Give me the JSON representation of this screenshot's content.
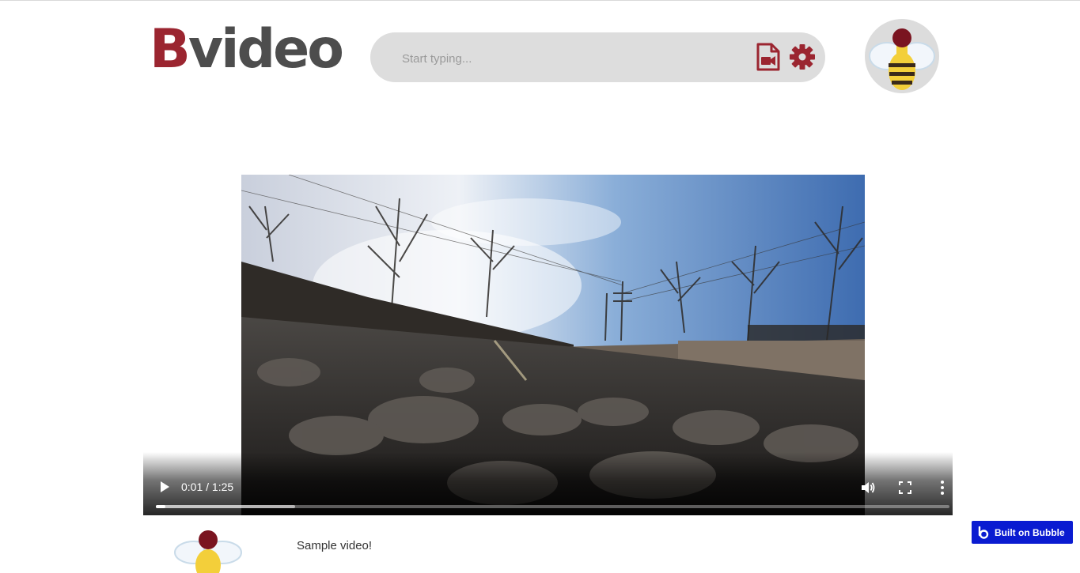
{
  "header": {
    "logo_initial": "B",
    "logo_rest": "video",
    "search": {
      "placeholder": "Start typing...",
      "value": ""
    },
    "icons": [
      "video-file-icon",
      "gear-icon"
    ],
    "accent_color": "#9b2530"
  },
  "player": {
    "current_time": "0:01",
    "separator": " / ",
    "duration": "1:25",
    "played_fraction": 0.012,
    "buffered_fraction": 0.175,
    "controls": [
      "play-icon",
      "volume-icon",
      "fullscreen-icon",
      "more-options-icon"
    ]
  },
  "video_info": {
    "title": "Sample video!"
  },
  "footer_badge": {
    "label": "Built on Bubble",
    "color": "#0a1bd1"
  }
}
